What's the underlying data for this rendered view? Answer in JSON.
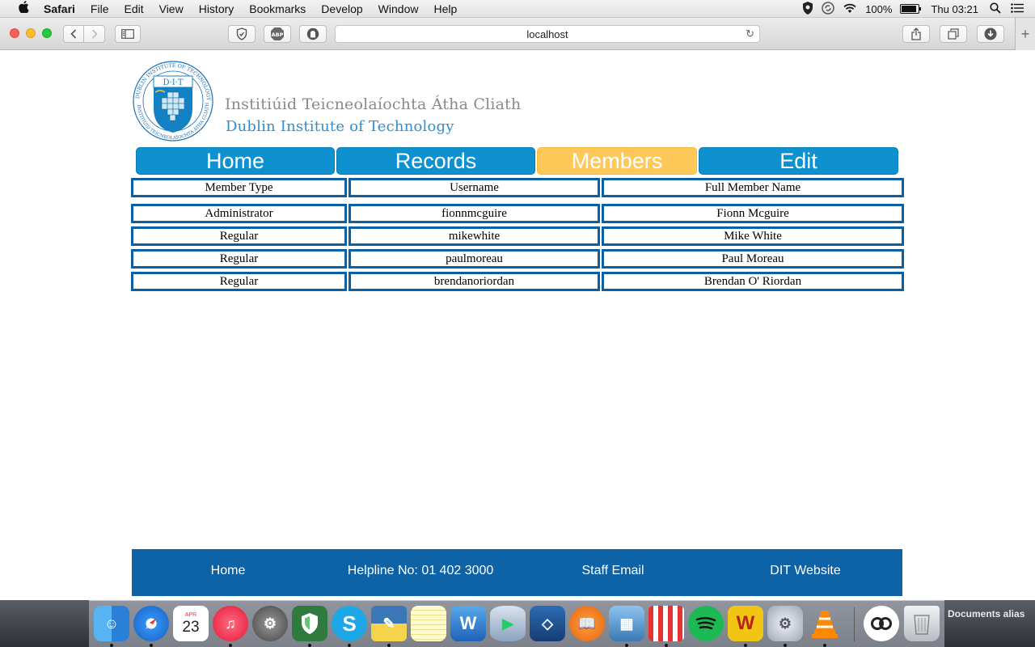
{
  "menubar": {
    "app": "Safari",
    "items": [
      "File",
      "Edit",
      "View",
      "History",
      "Bookmarks",
      "Develop",
      "Window",
      "Help"
    ],
    "battery": "100%",
    "clock": "Thu 03:21"
  },
  "browser": {
    "url": "localhost",
    "extensions": [
      "shield-icon",
      "abp-icon",
      "ghostery-icon"
    ],
    "adblock_label": "ABP"
  },
  "site": {
    "name_irish": "Institiúid Teicneolaíochta Átha Cliath",
    "name_english": "Dublin Institute of Technology",
    "logo": {
      "ring_text": "Dublin Institute of Technology · Institiúid Teicneolaíochta Átha Cliath",
      "initials": "D·I·T"
    },
    "nav": [
      {
        "label": "Home",
        "active": false
      },
      {
        "label": "Records",
        "active": false
      },
      {
        "label": "Members",
        "active": true
      },
      {
        "label": "Edit",
        "active": false
      }
    ],
    "colors": {
      "nav_blue": "#0f91d0",
      "nav_active": "#fec958",
      "table_border": "#0b5fa3",
      "footer": "#0e62a6"
    }
  },
  "members_table": {
    "headers": [
      "Member Type",
      "Username",
      "Full Member Name"
    ],
    "rows": [
      [
        "Administrator",
        "fionnmcguire",
        "Fionn Mcguire"
      ],
      [
        "Regular",
        "mikewhite",
        "Mike White"
      ],
      [
        "Regular",
        "paulmoreau",
        "Paul Moreau"
      ],
      [
        "Regular",
        "brendanoriordan",
        "Brendan O' Riordan"
      ]
    ]
  },
  "footer": {
    "links": [
      "Home",
      "Helpline No: 01 402 3000",
      "Staff Email",
      "DIT Website"
    ]
  },
  "dock": {
    "apps": [
      "finder-icon",
      "safari-icon",
      "calendar-icon",
      "itunes-icon",
      "system-preferences-icon",
      "adguard-icon",
      "skype-icon",
      "python-launcher-icon",
      "notes-icon",
      "word-icon",
      "sequel-db-icon",
      "virtualbox-icon",
      "ibooks-icon",
      "preview-icon",
      "popcorn-time-icon",
      "spotify-icon",
      "filezilla-icon",
      "settings-gear-icon",
      "vlc-icon",
      "link-icon",
      "trash-icon"
    ],
    "calendar_month": "APR",
    "calendar_day": "23",
    "stack_label": "Documents alias"
  }
}
